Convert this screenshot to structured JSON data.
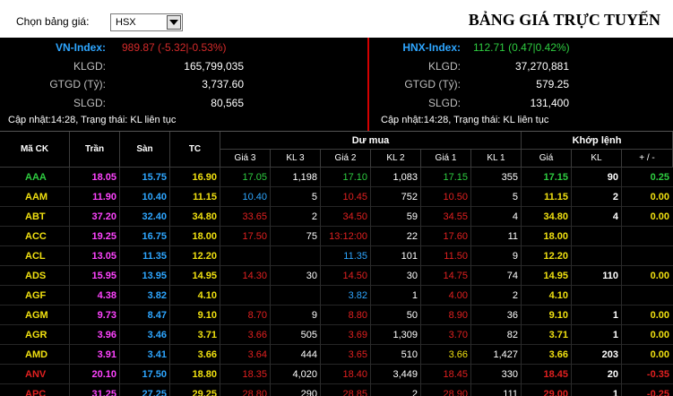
{
  "header": {
    "select_label": "Chọn bảng giá:",
    "select_value": "HSX",
    "title": "BẢNG GIÁ TRỰC TUYẾN"
  },
  "vn_index": {
    "name": "VN-Index:",
    "value": "989.87 (-5.32|-0.53%)",
    "value_color": "#d42a2a",
    "klgd_label": "KLGD:",
    "klgd": "165,799,035",
    "gtgd_label": "GTGD (Tỷ):",
    "gtgd": "3,737.60",
    "slgd_label": "SLGD:",
    "slgd": "80,565",
    "status": "Cập nhật:14:28,  Trạng thái: KL liên tục"
  },
  "hnx_index": {
    "name": "HNX-Index:",
    "value": "112.71 (0.47|0.42%)",
    "value_color": "#2ecc40",
    "klgd_label": "KLGD:",
    "klgd": "37,270,881",
    "gtgd_label": "GTGD (Tỷ):",
    "gtgd": "579.25",
    "slgd_label": "SLGD:",
    "slgd": "131,400",
    "status": "Cập nhật:14:28,  Trạng thái: KL liên tục"
  },
  "table": {
    "headers": {
      "symbol": "Mã CK",
      "ceil": "Trần",
      "floor": "Sàn",
      "ref": "TC",
      "buy_group": "Dư mua",
      "match_group": "Khớp lệnh",
      "g3": "Giá 3",
      "kl3": "KL 3",
      "g2": "Giá 2",
      "kl2": "KL 2",
      "g1": "Giá 1",
      "kl1": "KL 1",
      "price": "Giá",
      "kl": "KL",
      "chg": "+ / -"
    },
    "colors": {
      "up": "#2ecc40",
      "down": "#e02020",
      "ref": "#f0e010",
      "ceil": "#ff44ff",
      "floor": "#2ea6ff",
      "white": "#ffffff"
    },
    "rows": [
      {
        "sym": "AAA",
        "ceil": "18.05",
        "floor": "15.75",
        "ref": "16.90",
        "g3": "17.05",
        "kl3": "1,198",
        "g2": "17.10",
        "kl2": "1,083",
        "g1": "17.15",
        "kl1": "355",
        "price": "17.15",
        "kl": "90",
        "chg": "0.25",
        "c_sym": "up",
        "c_g3": "up",
        "c_g2": "up",
        "c_g1": "up",
        "c_m": "up"
      },
      {
        "sym": "AAM",
        "ceil": "11.90",
        "floor": "10.40",
        "ref": "11.15",
        "g3": "10.40",
        "kl3": "5",
        "g2": "10.45",
        "kl2": "752",
        "g1": "10.50",
        "kl1": "5",
        "price": "11.15",
        "kl": "2",
        "chg": "0.00",
        "c_sym": "ref",
        "c_g3": "floor",
        "c_g2": "down",
        "c_g1": "down",
        "c_m": "ref"
      },
      {
        "sym": "ABT",
        "ceil": "37.20",
        "floor": "32.40",
        "ref": "34.80",
        "g3": "33.65",
        "kl3": "2",
        "g2": "34.50",
        "kl2": "59",
        "g1": "34.55",
        "kl1": "4",
        "price": "34.80",
        "kl": "4",
        "chg": "0.00",
        "c_sym": "ref",
        "c_g3": "down",
        "c_g2": "down",
        "c_g1": "down",
        "c_m": "ref"
      },
      {
        "sym": "ACC",
        "ceil": "19.25",
        "floor": "16.75",
        "ref": "18.00",
        "g3": "17.50",
        "kl3": "75",
        "g2": "13:12:00",
        "kl2": "22",
        "g1": "17.60",
        "kl1": "11",
        "price": "18.00",
        "kl": "",
        "chg": "",
        "c_sym": "ref",
        "c_g3": "down",
        "c_g2": "down",
        "c_g1": "down",
        "c_m": "ref"
      },
      {
        "sym": "ACL",
        "ceil": "13.05",
        "floor": "11.35",
        "ref": "12.20",
        "g3": "",
        "kl3": "",
        "g2": "11.35",
        "kl2": "101",
        "g1": "11.50",
        "kl1": "9",
        "price": "12.20",
        "kl": "",
        "chg": "",
        "c_sym": "ref",
        "c_g3": "down",
        "c_g2": "floor",
        "c_g1": "down",
        "c_m": "ref"
      },
      {
        "sym": "ADS",
        "ceil": "15.95",
        "floor": "13.95",
        "ref": "14.95",
        "g3": "14.30",
        "kl3": "30",
        "g2": "14.50",
        "kl2": "30",
        "g1": "14.75",
        "kl1": "74",
        "price": "14.95",
        "kl": "110",
        "chg": "0.00",
        "c_sym": "ref",
        "c_g3": "down",
        "c_g2": "down",
        "c_g1": "down",
        "c_m": "ref"
      },
      {
        "sym": "AGF",
        "ceil": "4.38",
        "floor": "3.82",
        "ref": "4.10",
        "g3": "",
        "kl3": "",
        "g2": "3.82",
        "kl2": "1",
        "g1": "4.00",
        "kl1": "2",
        "price": "4.10",
        "kl": "",
        "chg": "",
        "c_sym": "ref",
        "c_g3": "down",
        "c_g2": "floor",
        "c_g1": "down",
        "c_m": "ref"
      },
      {
        "sym": "AGM",
        "ceil": "9.73",
        "floor": "8.47",
        "ref": "9.10",
        "g3": "8.70",
        "kl3": "9",
        "g2": "8.80",
        "kl2": "50",
        "g1": "8.90",
        "kl1": "36",
        "price": "9.10",
        "kl": "1",
        "chg": "0.00",
        "c_sym": "ref",
        "c_g3": "down",
        "c_g2": "down",
        "c_g1": "down",
        "c_m": "ref"
      },
      {
        "sym": "AGR",
        "ceil": "3.96",
        "floor": "3.46",
        "ref": "3.71",
        "g3": "3.66",
        "kl3": "505",
        "g2": "3.69",
        "kl2": "1,309",
        "g1": "3.70",
        "kl1": "82",
        "price": "3.71",
        "kl": "1",
        "chg": "0.00",
        "c_sym": "ref",
        "c_g3": "down",
        "c_g2": "down",
        "c_g1": "down",
        "c_m": "ref"
      },
      {
        "sym": "AMD",
        "ceil": "3.91",
        "floor": "3.41",
        "ref": "3.66",
        "g3": "3.64",
        "kl3": "444",
        "g2": "3.65",
        "kl2": "510",
        "g1": "3.66",
        "kl1": "1,427",
        "price": "3.66",
        "kl": "203",
        "chg": "0.00",
        "c_sym": "ref",
        "c_g3": "down",
        "c_g2": "down",
        "c_g1": "ref",
        "c_m": "ref"
      },
      {
        "sym": "ANV",
        "ceil": "20.10",
        "floor": "17.50",
        "ref": "18.80",
        "g3": "18.35",
        "kl3": "4,020",
        "g2": "18.40",
        "kl2": "3,449",
        "g1": "18.45",
        "kl1": "330",
        "price": "18.45",
        "kl": "20",
        "chg": "-0.35",
        "c_sym": "down",
        "c_g3": "down",
        "c_g2": "down",
        "c_g1": "down",
        "c_m": "down"
      },
      {
        "sym": "APC",
        "ceil": "31.25",
        "floor": "27.25",
        "ref": "29.25",
        "g3": "28.80",
        "kl3": "290",
        "g2": "28.85",
        "kl2": "2",
        "g1": "28.90",
        "kl1": "111",
        "price": "29.00",
        "kl": "1",
        "chg": "-0.25",
        "c_sym": "down",
        "c_g3": "down",
        "c_g2": "down",
        "c_g1": "down",
        "c_m": "down"
      }
    ]
  }
}
